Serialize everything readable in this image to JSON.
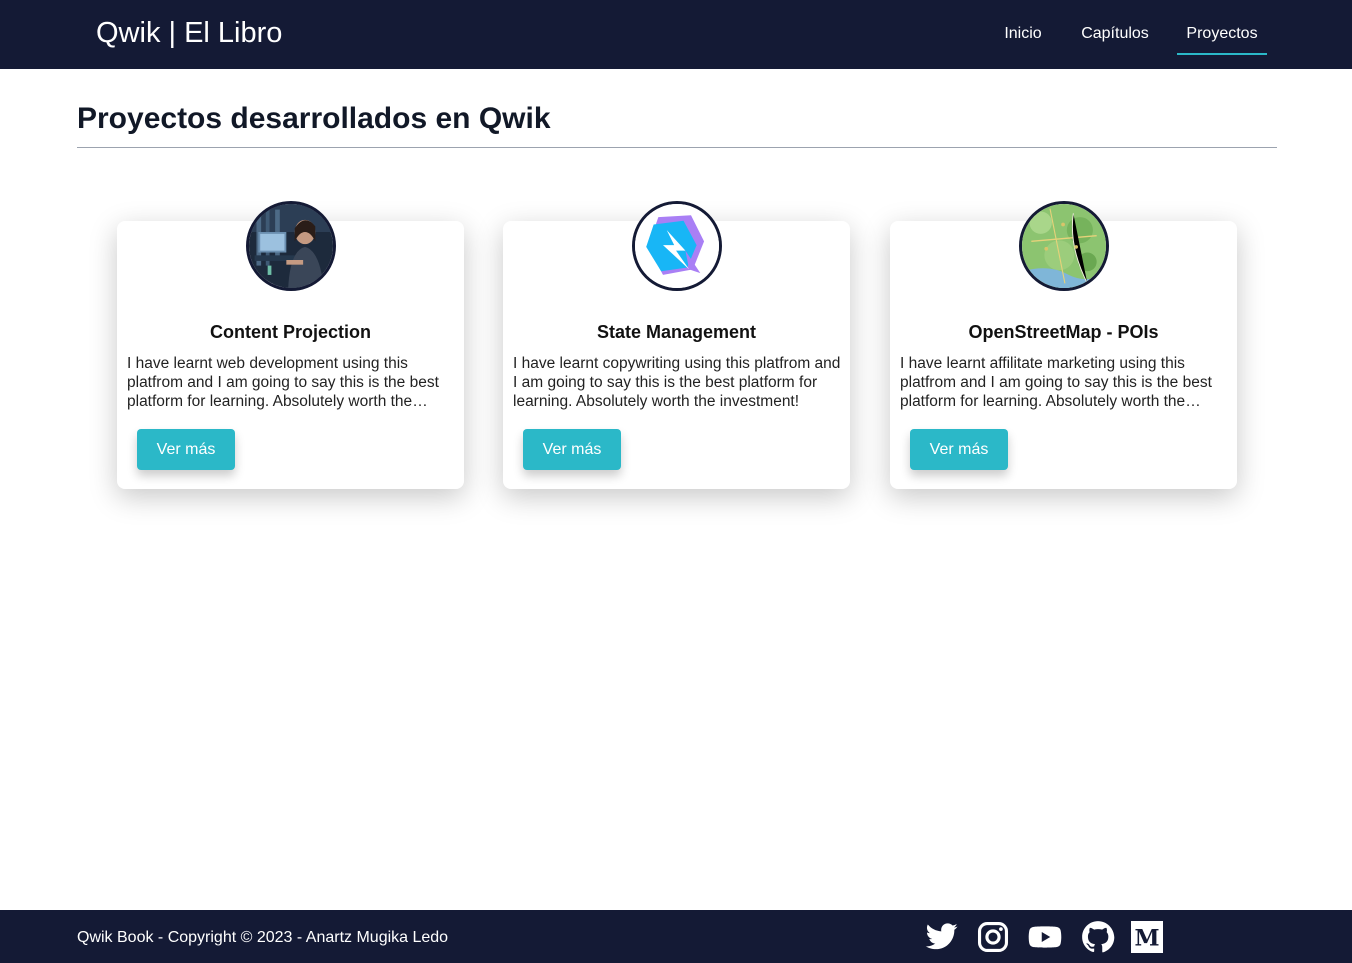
{
  "header": {
    "brand": "Qwik | El Libro",
    "nav": [
      {
        "label": "Inicio",
        "active": false
      },
      {
        "label": "Capítulos",
        "active": false
      },
      {
        "label": "Proyectos",
        "active": true
      }
    ]
  },
  "main": {
    "title": "Proyectos desarrollados en Qwik",
    "cards": [
      {
        "title": "Content Projection",
        "text": "I have learnt web development using this platfrom and I am going to say this is the best platform for learning. Absolutely worth the investment!",
        "button": "Ver más",
        "image": "person-at-computer-photo"
      },
      {
        "title": "State Management",
        "text": "I have learnt copywriting using this platfrom and I am going to say this is the best platform for learning. Absolutely worth the investment!",
        "button": "Ver más",
        "image": "qwik-logo"
      },
      {
        "title": "OpenStreetMap - POIs",
        "text": "I have learnt affilitate marketing using this platfrom and I am going to say this is the best platform for learning. Absolutely worth the investment!",
        "button": "Ver más",
        "image": "green-map-tile"
      }
    ]
  },
  "footer": {
    "copyright": "Qwik Book - Copyright © 2023 - Anartz Mugika Ledo",
    "social": [
      "twitter-icon",
      "instagram-icon",
      "youtube-icon",
      "github-icon",
      "medium-icon"
    ]
  },
  "colors": {
    "navbar": "#141a35",
    "accent": "#2bb8c8",
    "text": "#111827"
  }
}
